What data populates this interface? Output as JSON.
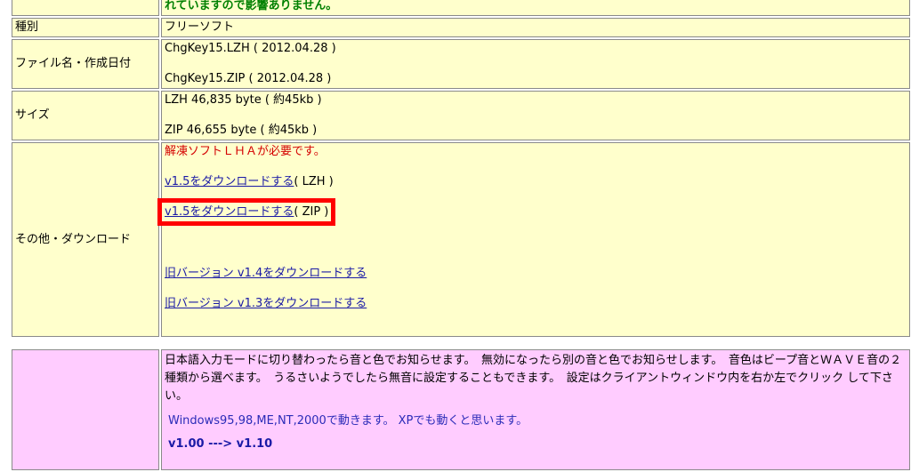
{
  "top_note": "れていますので影響ありません。",
  "rows": {
    "kind": {
      "label": "種別",
      "value": "フリーソフト"
    },
    "file": {
      "label": "ファイル名・作成日付",
      "lzh": "ChgKey15.LZH ( 2012.04.28 )",
      "zip": "ChgKey15.ZIP ( 2012.04.28 )"
    },
    "size": {
      "label": "サイズ",
      "lzh": "LZH  46,835 byte ( 約45kb )",
      "zip": "ZIP  46,655 byte ( 約45kb )"
    },
    "download": {
      "label": "その他・ダウンロード",
      "note": "解凍ソフトＬＨＡが必要です。",
      "lzh_link": "v1.5をダウンロードする",
      "lzh_suffix": "( LZH )",
      "zip_link": "v1.5をダウンロードする",
      "zip_suffix": "( ZIP )",
      "old14": "旧バージョン v1.4をダウンロードする",
      "old13": "旧バージョン v1.3をダウンロードする"
    }
  },
  "desc": {
    "text": "日本語入力モードに切り替わったら音と色でお知らせます。　無効になったら別の音と色でお知らせします。　音色はビープ音とＷＡＶＥ音の２種類から選べます。　うるさいようでしたら無音に設定することもできます。　設定はクライアントウィンドウ内を右か左でクリック して下さい。",
    "os": "Windows95,98,ME,NT,2000で動きます。 XPでも動くと思います。",
    "version": "v1.00 ---> v1.10"
  }
}
